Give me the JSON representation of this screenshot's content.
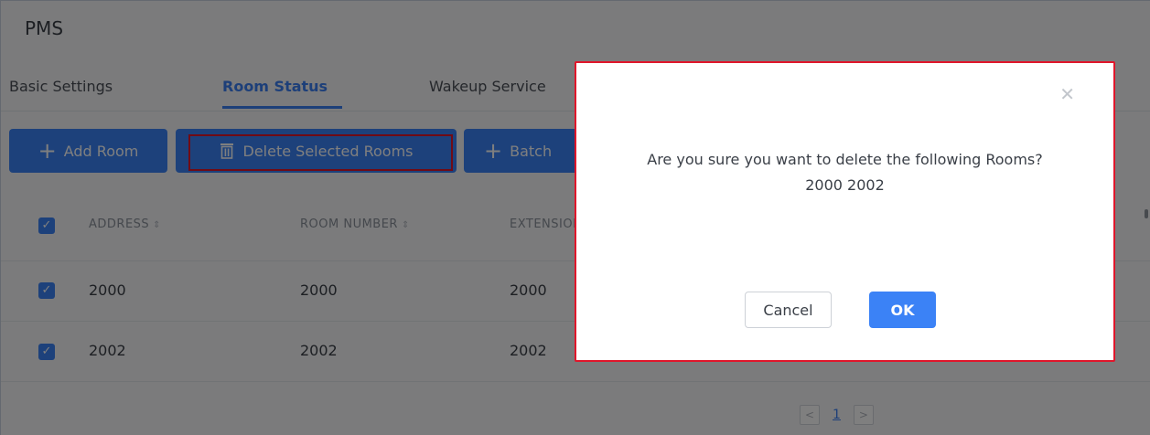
{
  "page": {
    "title": "PMS"
  },
  "tabs": [
    {
      "label": "Basic Settings",
      "active": false
    },
    {
      "label": "Room Status",
      "active": true
    },
    {
      "label": "Wakeup Service",
      "active": false
    }
  ],
  "toolbar": {
    "add_room_label": "Add Room",
    "delete_selected_label": "Delete Selected Rooms",
    "batch_label": "Batch"
  },
  "table": {
    "headers": [
      "ADDRESS",
      "ROOM NUMBER",
      "EXTENSION"
    ],
    "rows": [
      {
        "checked": true,
        "address": "2000",
        "room_number": "2000",
        "extension": "2000"
      },
      {
        "checked": true,
        "address": "2002",
        "room_number": "2002",
        "extension": "2002"
      }
    ]
  },
  "pagination": {
    "current_page": "1"
  },
  "dialog": {
    "message": "Are you sure you want to delete the following Rooms?",
    "rooms": "2000 2002",
    "cancel_label": "Cancel",
    "ok_label": "OK",
    "close_icon": "close-icon"
  },
  "colors": {
    "accent": "#3b82f6",
    "highlight": "#e0162b"
  }
}
